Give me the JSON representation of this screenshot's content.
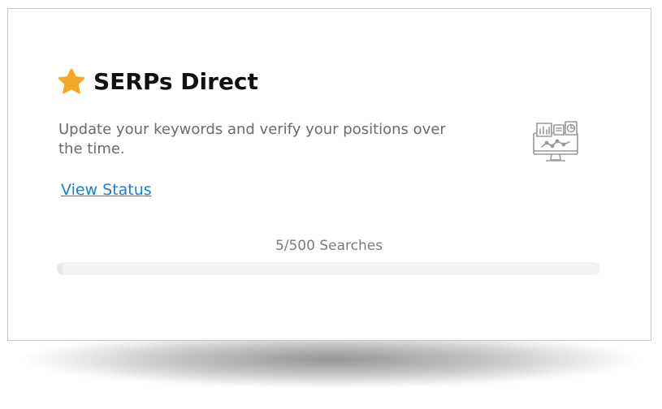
{
  "card": {
    "title": "SERPs Direct",
    "title_icon": "star-icon",
    "description": "Update your keywords and verify your positions over the time.",
    "link_label": "View Status",
    "illustration_icon": "analytics-dashboard-icon"
  },
  "usage": {
    "label": "5/500 Searches",
    "used": 5,
    "total": 500
  },
  "colors": {
    "star": "#F5A623",
    "link": "#1A7ED6",
    "title": "#111111",
    "text": "#6B6B6B",
    "track": "#F2F2F2"
  }
}
